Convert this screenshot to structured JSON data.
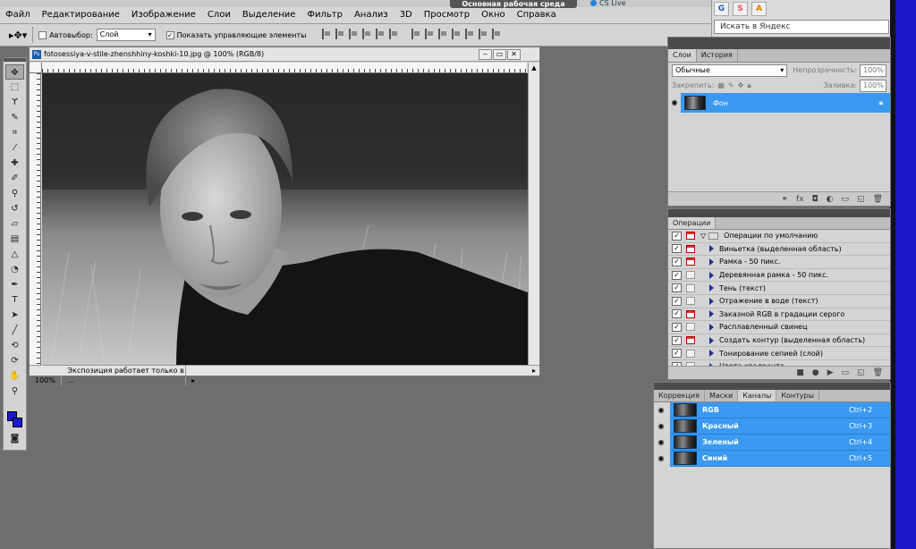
{
  "menu": {
    "items": [
      "Файл",
      "Редактирование",
      "Изображение",
      "Слои",
      "Выделение",
      "Фильтр",
      "Анализ",
      "3D",
      "Просмотр",
      "Окно",
      "Справка"
    ],
    "workspace_button": "Основная рабочая среда",
    "cs_live": "CS Live"
  },
  "options": {
    "autoselect_label": "Автовыбор:",
    "autoselect_value": "Слой",
    "show_controls_label": "Показать управляющие элементы"
  },
  "browser": {
    "tabs": [
      "G",
      "S",
      "A"
    ],
    "search_placeholder": "Искать в Яндекс"
  },
  "document": {
    "title": "fotosessiya-v-stile-zhenshhiny-koshki-10.jpg @ 100% (RGB/8)",
    "zoom": "100%",
    "status": "Экспозиция работает только в ..."
  },
  "layers": {
    "tabs": [
      "Слои",
      "История"
    ],
    "blend_mode": "Обычные",
    "opacity_label": "Непрозрачность:",
    "opacity_value": "100%",
    "lock_label": "Закрепить:",
    "fill_label": "Заливка:",
    "fill_value": "100%",
    "layer_name": "Фон"
  },
  "actions": {
    "tab": "Операции",
    "set_name": "Операции по умолчанию",
    "items": [
      {
        "name": "Виньетка (выделенная область)",
        "dialog": true
      },
      {
        "name": "Рамка - 50 пикс.",
        "dialog": true
      },
      {
        "name": "Деревянная рамка - 50 пикс.",
        "dialog": false
      },
      {
        "name": "Тень (текст)",
        "dialog": false
      },
      {
        "name": "Отражение в воде (текст)",
        "dialog": false
      },
      {
        "name": "Заказной RGB в градации серого",
        "dialog": true
      },
      {
        "name": "Расплавленный свинец",
        "dialog": false
      },
      {
        "name": "Создать контур (выделенная область)",
        "dialog": true
      },
      {
        "name": "Тонирование сепией (слой)",
        "dialog": false
      },
      {
        "name": "Цвета квадранта",
        "dialog": false
      }
    ]
  },
  "channels": {
    "tabs": [
      "Коррекция",
      "Маски",
      "Каналы",
      "Контуры"
    ],
    "active_tab": "Каналы",
    "items": [
      {
        "name": "RGB",
        "shortcut": "Ctrl+2"
      },
      {
        "name": "Красный",
        "shortcut": "Ctrl+3"
      },
      {
        "name": "Зеленый",
        "shortcut": "Ctrl+4"
      },
      {
        "name": "Синий",
        "shortcut": "Ctrl+5"
      }
    ]
  },
  "colors": {
    "foreground": "#1c1ad0",
    "background": "#1c1ad0",
    "selection_blue": "#3b99f1"
  }
}
